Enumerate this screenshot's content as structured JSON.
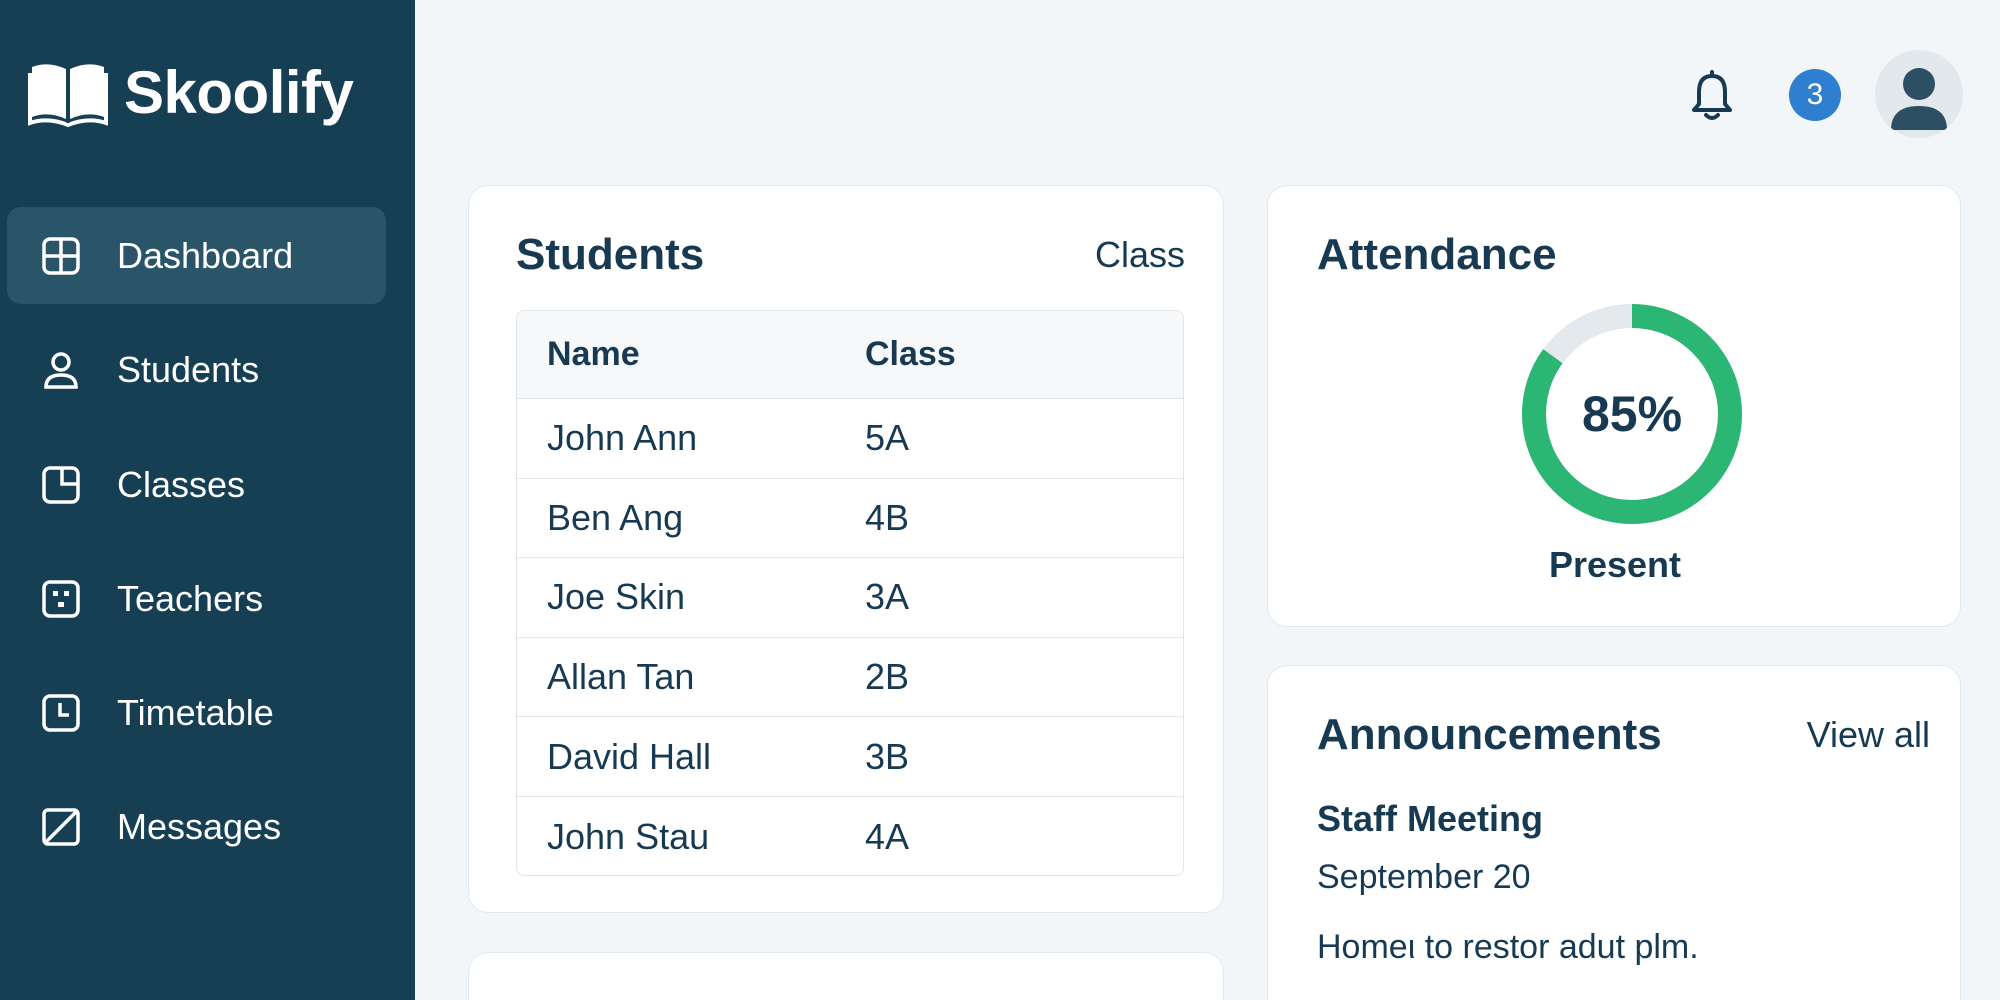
{
  "app": {
    "name": "Skoolify"
  },
  "sidebar": {
    "items": [
      {
        "label": "Dashboard",
        "icon": "dashboard-icon",
        "active": true
      },
      {
        "label": "Students",
        "icon": "user-icon",
        "active": false
      },
      {
        "label": "Classes",
        "icon": "classes-icon",
        "active": false
      },
      {
        "label": "Teachers",
        "icon": "teachers-icon",
        "active": false
      },
      {
        "label": "Timetable",
        "icon": "clock-icon",
        "active": false
      },
      {
        "label": "Messages",
        "icon": "messages-icon",
        "active": false
      }
    ]
  },
  "topbar": {
    "notification_count": "3",
    "icons": [
      "bell-icon",
      "avatar"
    ]
  },
  "students": {
    "title": "Students",
    "filter_label": "Class",
    "columns": {
      "name": "Name",
      "class": "Class"
    },
    "rows": [
      {
        "name": "John Ann",
        "class": "5A"
      },
      {
        "name": "Ben Ang",
        "class": "4B"
      },
      {
        "name": "Joe Skin",
        "class": "3A"
      },
      {
        "name": "Allan Tan",
        "class": "2B"
      },
      {
        "name": "David Hall",
        "class": "3B"
      },
      {
        "name": "John Stau",
        "class": "4A"
      }
    ]
  },
  "attendance": {
    "title": "Attendance",
    "value_label": "85%",
    "fraction": 0.85,
    "status_label": "Present",
    "colors": {
      "fill": "#2bb673",
      "track": "#e3e9ed"
    }
  },
  "announcements": {
    "title": "Announcements",
    "view_all_label": "View all",
    "items": [
      {
        "title": "Staff Meeting",
        "date": "September 20",
        "body": "Homeι to restor adut plm."
      }
    ]
  },
  "colors": {
    "sidebar_bg": "#163f54",
    "sidebar_active": "#2a5568",
    "badge": "#2f7fd1",
    "text": "#173a52"
  }
}
